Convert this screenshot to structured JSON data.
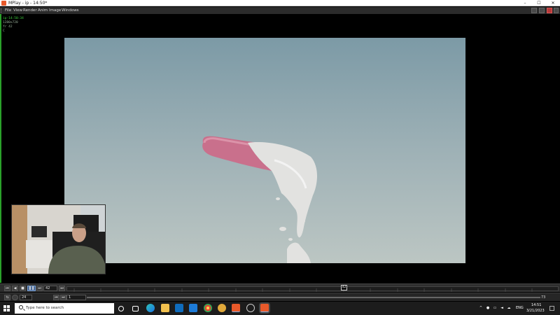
{
  "window": {
    "title": "MPlay - ip - 14:50*",
    "controls": {
      "minimize": "–",
      "maximize": "☐",
      "close": "✕"
    }
  },
  "menu": {
    "items": [
      "File",
      "View",
      "Render",
      "Anim",
      "Image",
      "Windows"
    ]
  },
  "viewer": {
    "info_line1": "ip-14:50:34",
    "info_line2": "1280x720",
    "info_line3": "fr 42",
    "info_line4": "C"
  },
  "playbar": {
    "current_frame": "42",
    "fps": "24",
    "range_start": "1",
    "range_end": "73",
    "frame_marker": "42",
    "btn_first": "⏮",
    "btn_prev": "◀",
    "btn_stop": "■",
    "btn_play": "❚❚",
    "btn_next": "⏭",
    "btn_end": "⏭",
    "btn_loop": "⇆",
    "btn_step_back": "⏮",
    "btn_step_fwd": "⏭"
  },
  "taskbar": {
    "search_placeholder": "Type here to search",
    "language": "ENG",
    "time": "14:51",
    "date": "3/21/2023"
  },
  "colors": {
    "info_text": "#3fd33f",
    "render_top": "#7c9aa6",
    "render_bottom": "#bcc6c3",
    "tube": "#c9708c",
    "fluid": "#e2e2e0"
  }
}
